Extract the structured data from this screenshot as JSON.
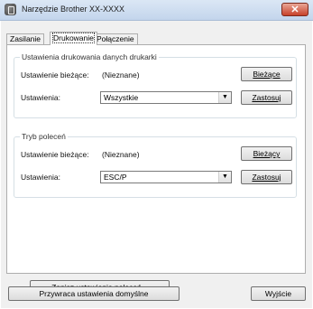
{
  "window": {
    "title": "Narzędzie Brother XX-XXXX",
    "close_glyph": "✕"
  },
  "tabs": [
    {
      "label": "Zasilanie",
      "active": false
    },
    {
      "label": "Drukowanie",
      "active": true
    },
    {
      "label": "Połączenie",
      "active": false
    }
  ],
  "print_settings": {
    "group_title": "Ustawienia drukowania danych drukarki",
    "current_label": "Ustawienie bieżące:",
    "current_value": "(Nieznane)",
    "current_button": "Bieżące",
    "settings_label": "Ustawienia:",
    "settings_value": "Wszystkie",
    "apply_button": "Zastosuj"
  },
  "command_mode": {
    "group_title": "Tryb poleceń",
    "current_label": "Ustawienie bieżące:",
    "current_value": "(Nieznane)",
    "current_button": "Bieżący",
    "settings_label": "Ustawienia:",
    "settings_value": "ESC/P",
    "apply_button": "Zastosuj"
  },
  "save_commands_button": "Zapisz ustawienia poleceń...",
  "restore_defaults_button": "Przywraca ustawienia domyślne",
  "exit_button": "Wyjście",
  "icons": {
    "dropdown": "▼",
    "app": "printer-tool-icon",
    "close": "close-icon"
  },
  "colors": {
    "titlebar": "#c3d5ec",
    "close": "#c7412a",
    "panel": "#ffffff"
  }
}
